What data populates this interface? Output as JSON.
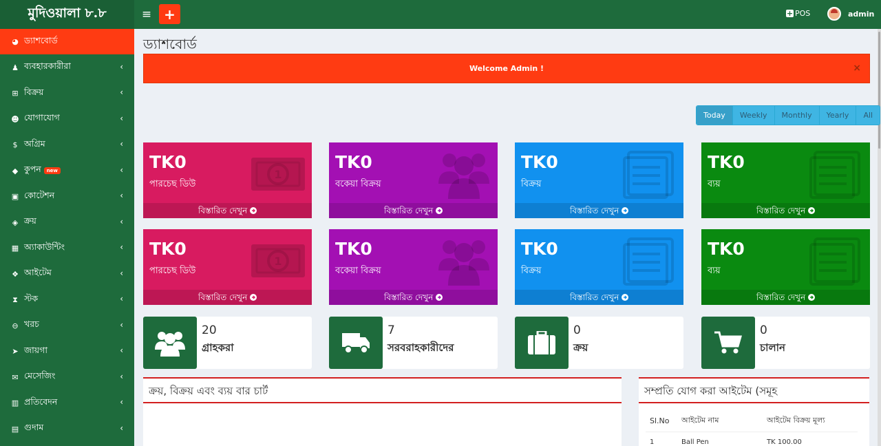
{
  "app": {
    "logo": "মুদিওয়ালা ৮.৮"
  },
  "header": {
    "menu_icon": "≡",
    "add_icon": "+",
    "pos_label": "POS",
    "user_name": "admin"
  },
  "sidebar": {
    "items": [
      {
        "label": "ড্যাশবোর্ড",
        "icon": "dashboard-icon",
        "glyph": "◕",
        "chevron": ""
      },
      {
        "label": "ব্যবহারকারীরা",
        "icon": "users-icon",
        "glyph": "♟",
        "chevron": "‹"
      },
      {
        "label": "বিক্রয়",
        "icon": "cart-icon",
        "glyph": "⊞",
        "chevron": "‹"
      },
      {
        "label": "যোগাযোগ",
        "icon": "contacts-icon",
        "glyph": "☻",
        "chevron": "‹"
      },
      {
        "label": "অগ্রিম",
        "icon": "dollar-icon",
        "glyph": "$",
        "chevron": "‹"
      },
      {
        "label": "কুপন",
        "icon": "tags-icon",
        "glyph": "◆",
        "chevron": "‹",
        "badge": "new"
      },
      {
        "label": "কোটেশন",
        "icon": "calendar-plus-icon",
        "glyph": "▣",
        "chevron": "‹"
      },
      {
        "label": "ক্রয়",
        "icon": "cube-icon",
        "glyph": "◈",
        "chevron": "‹"
      },
      {
        "label": "অ্যাকাউন্টিং",
        "icon": "th-large-icon",
        "glyph": "▦",
        "chevron": "‹"
      },
      {
        "label": "আইটেম",
        "icon": "cubes-icon",
        "glyph": "❖",
        "chevron": "‹"
      },
      {
        "label": "স্টক",
        "icon": "hourglass-icon",
        "glyph": "⧗",
        "chevron": "‹"
      },
      {
        "label": "খরচ",
        "icon": "minus-circle-icon",
        "glyph": "⊖",
        "chevron": "‹"
      },
      {
        "label": "জায়গা",
        "icon": "location-arrow-icon",
        "glyph": "➤",
        "chevron": "‹"
      },
      {
        "label": "মেসেজিং",
        "icon": "envelope-icon",
        "glyph": "✉",
        "chevron": "‹"
      },
      {
        "label": "প্রতিবেদন",
        "icon": "bar-chart-icon",
        "glyph": "▥",
        "chevron": "‹"
      },
      {
        "label": "গুদাম",
        "icon": "building-icon",
        "glyph": "▤",
        "chevron": "‹"
      }
    ]
  },
  "page": {
    "title": "ড্যাশবোর্ড"
  },
  "alert": {
    "text": "Welcome Admin !",
    "close": "×"
  },
  "range": [
    "Today",
    "Weekly",
    "Monthly",
    "Yearly",
    "All"
  ],
  "stat_boxes": [
    {
      "value": "TK0",
      "label": "পারচেছ ডিউ",
      "footer": "বিস্তারিত দেখুন",
      "color": "#d81b60",
      "icon": "money-icon"
    },
    {
      "value": "TK0",
      "label": "বকেয়া বিক্রয়",
      "footer": "বিস্তারিত দেখুন",
      "color": "#a310b3",
      "icon": "users-icon"
    },
    {
      "value": "TK0",
      "label": "বিক্রয়",
      "footer": "বিস্তারিত দেখুন",
      "color": "#1191ef",
      "icon": "list-alt-icon"
    },
    {
      "value": "TK0",
      "label": "ব্যয়",
      "footer": "বিস্তারিত দেখুন",
      "color": "#0a8a10",
      "icon": "list-alt-icon"
    },
    {
      "value": "TK0",
      "label": "পারচেছ ডিউ",
      "footer": "বিস্তারিত দেখুন",
      "color": "#d81b60",
      "icon": "money-icon"
    },
    {
      "value": "TK0",
      "label": "বকেয়া বিক্রয়",
      "footer": "বিস্তারিত দেখুন",
      "color": "#a310b3",
      "icon": "users-icon"
    },
    {
      "value": "TK0",
      "label": "বিক্রয়",
      "footer": "বিস্তারিত দেখুন",
      "color": "#1191ef",
      "icon": "list-alt-icon"
    },
    {
      "value": "TK0",
      "label": "ব্যয়",
      "footer": "বিস্তারিত দেখুন",
      "color": "#0a8a10",
      "icon": "list-alt-icon"
    }
  ],
  "info_boxes": [
    {
      "number": "20",
      "label": "গ্রাহকরা",
      "icon": "customers-icon"
    },
    {
      "number": "7",
      "label": "সরবরাহকারীদের",
      "icon": "truck-icon"
    },
    {
      "number": "0",
      "label": "ক্রয়",
      "icon": "briefcase-icon"
    },
    {
      "number": "0",
      "label": "চালান",
      "icon": "shopping-cart-icon"
    }
  ],
  "chart_panel": {
    "title": "ক্রয়, বিক্রয় এবং ব্যয় বার চার্ট"
  },
  "recent_items": {
    "title": "সম্প্রতি যোগ করা আইটেম (সমূহ",
    "headers": [
      "Sl.No",
      "আইটেম নাম",
      "আইটেম বিক্রয় মূল্য"
    ],
    "rows": [
      [
        "1",
        "Ball Pen",
        "TK 100.00"
      ]
    ]
  }
}
